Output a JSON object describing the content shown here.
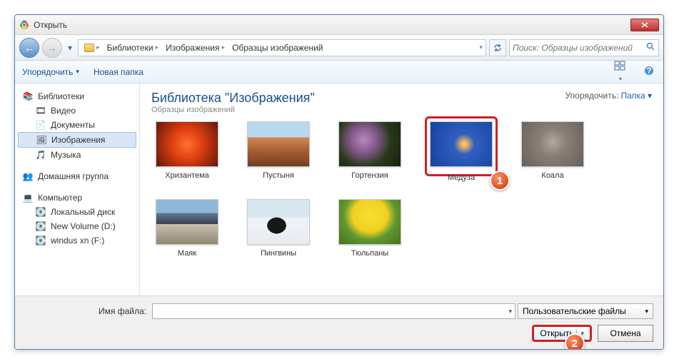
{
  "title": "Открыть",
  "breadcrumb": {
    "seg1": "Библиотеки",
    "seg2": "Изображения",
    "seg3": "Образцы изображений"
  },
  "search": {
    "placeholder": "Поиск: Образцы изображений"
  },
  "toolbar": {
    "organize": "Упорядочить",
    "newfolder": "Новая папка"
  },
  "sidebar": {
    "libraries": "Библиотеки",
    "video": "Видео",
    "documents": "Документы",
    "pictures": "Изображения",
    "music": "Музыка",
    "homegroup": "Домашняя группа",
    "computer": "Компьютер",
    "localdisk": "Локальный диск",
    "newvolume": "New Volume (D:)",
    "windus": "windus xn (F:)"
  },
  "content": {
    "title": "Библиотека \"Изображения\"",
    "subtitle": "Образцы изображений",
    "arrange_label": "Упорядочить:",
    "arrange_value": "Папка"
  },
  "thumbs": {
    "chrys": "Хризантема",
    "desert": "Пустыня",
    "hydra": "Гортензия",
    "jelly": "Медуза",
    "koala": "Коала",
    "light": "Маяк",
    "peng": "Пингвины",
    "tulip": "Тюльпаны"
  },
  "markers": {
    "m1": "1",
    "m2": "2"
  },
  "footer": {
    "filename_label": "Имя файла:",
    "filetype": "Пользовательские файлы",
    "open": "Открыть",
    "cancel": "Отмена"
  }
}
